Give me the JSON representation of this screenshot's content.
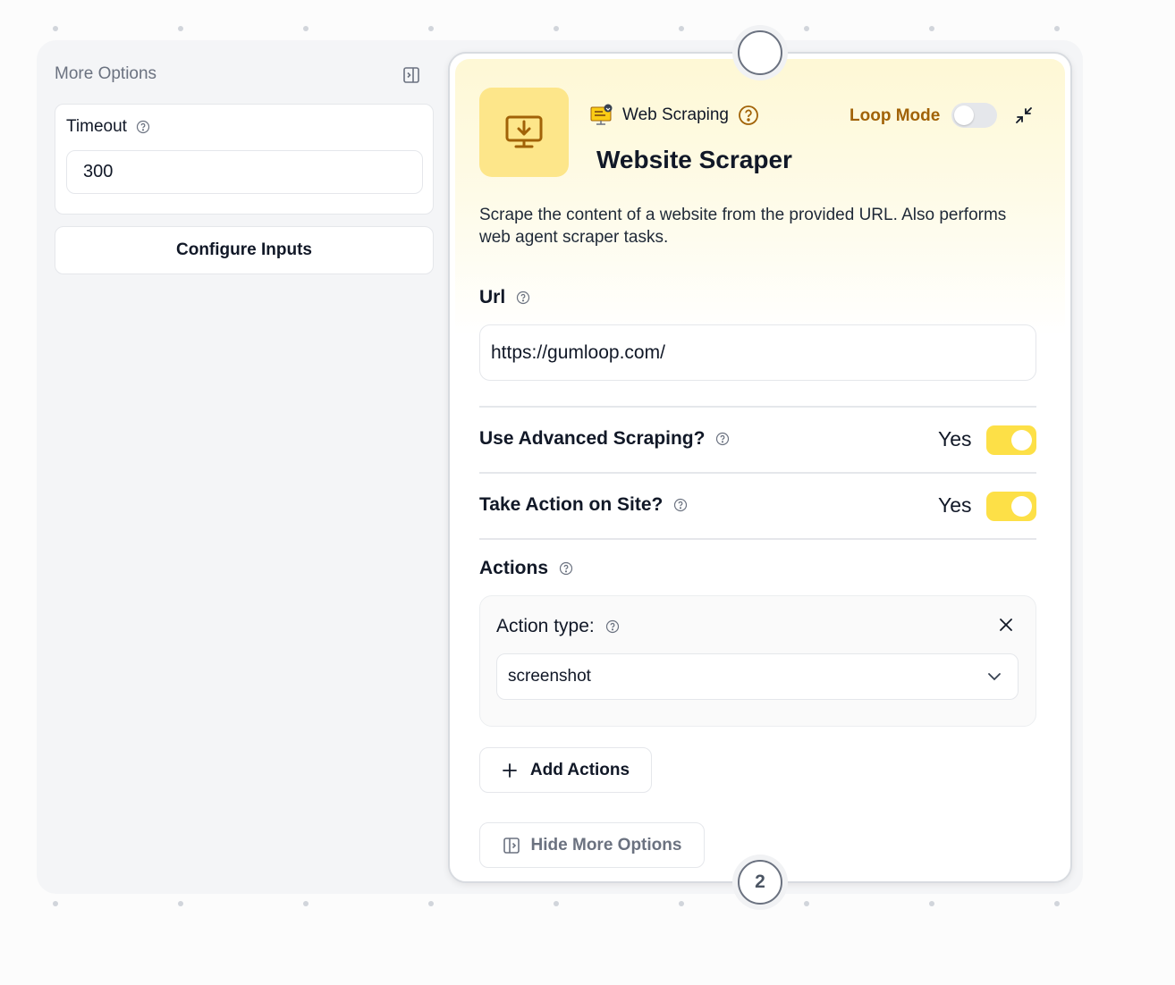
{
  "more_options": {
    "title": "More Options",
    "timeout": {
      "label": "Timeout",
      "value": "300"
    },
    "configure_inputs_label": "Configure Inputs"
  },
  "node": {
    "category": "Web Scraping",
    "loop_mode_label": "Loop Mode",
    "loop_mode_on": false,
    "title": "Website Scraper",
    "description": "Scrape the content of a website from the provided URL. Also performs web agent scraper tasks.",
    "url": {
      "label": "Url",
      "value": "https://gumloop.com/"
    },
    "advanced_scraping": {
      "label": "Use Advanced Scraping?",
      "value": "Yes",
      "enabled": true
    },
    "take_action": {
      "label": "Take Action on Site?",
      "value": "Yes",
      "enabled": true
    },
    "actions": {
      "label": "Actions",
      "items": [
        {
          "type_label": "Action type:",
          "type_value": "screenshot"
        }
      ],
      "add_label": "Add Actions"
    },
    "hide_more_options_label": "Hide More Options",
    "output_handle_label": "2"
  },
  "colors": {
    "accent_yellow": "#fde047",
    "loop_mode_text": "#a16207",
    "icon_bg": "#fde68a"
  }
}
